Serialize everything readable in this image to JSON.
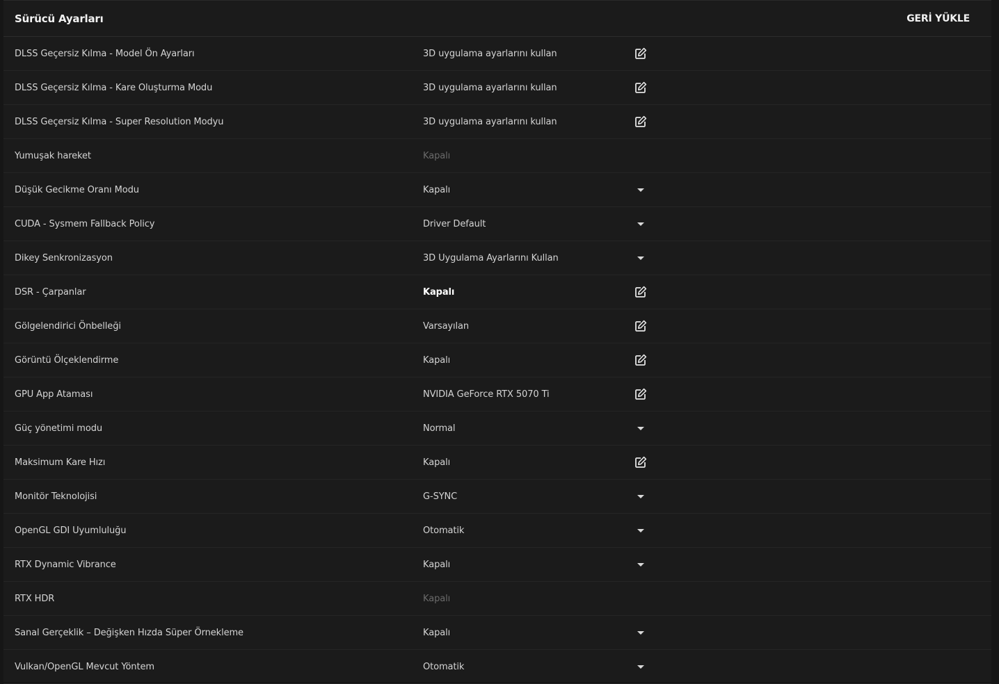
{
  "header": {
    "title": "Sürücü Ayarları",
    "restore_label": "GERİ YÜKLE"
  },
  "settings": [
    {
      "label": "DLSS Geçersiz Kılma - Model Ön Ayarları",
      "value": "3D uygulama ayarlarını kullan",
      "control": "edit-icon",
      "state": "normal"
    },
    {
      "label": "DLSS Geçersiz Kılma - Kare Oluşturma Modu",
      "value": "3D uygulama ayarlarını kullan",
      "control": "edit-icon",
      "state": "normal"
    },
    {
      "label": "DLSS Geçersiz Kılma - Super Resolution Modyu",
      "value": "3D uygulama ayarlarını kullan",
      "control": "edit-icon",
      "state": "normal"
    },
    {
      "label": "Yumuşak hareket",
      "value": "Kapalı",
      "control": "none",
      "state": "disabled"
    },
    {
      "label": "Düşük Gecikme Oranı Modu",
      "value": "Kapalı",
      "control": "dropdown-caret-icon",
      "state": "normal"
    },
    {
      "label": "CUDA - Sysmem Fallback Policy",
      "value": "Driver Default",
      "control": "dropdown-caret-icon",
      "state": "normal"
    },
    {
      "label": "Dikey Senkronizasyon",
      "value": "3D Uygulama Ayarlarını Kullan",
      "control": "dropdown-caret-icon",
      "state": "normal"
    },
    {
      "label": "DSR - Çarpanlar",
      "value": "Kapalı",
      "control": "edit-icon",
      "state": "bold"
    },
    {
      "label": "Gölgelendirici Önbelleği",
      "value": "Varsayılan",
      "control": "edit-icon",
      "state": "normal"
    },
    {
      "label": "Görüntü Ölçeklendirme",
      "value": "Kapalı",
      "control": "edit-icon",
      "state": "normal"
    },
    {
      "label": "GPU App Ataması",
      "value": "NVIDIA GeForce RTX 5070 Ti",
      "control": "edit-icon",
      "state": "normal"
    },
    {
      "label": "Güç yönetimi modu",
      "value": "Normal",
      "control": "dropdown-caret-icon",
      "state": "normal"
    },
    {
      "label": "Maksimum Kare Hızı",
      "value": "Kapalı",
      "control": "edit-icon",
      "state": "normal"
    },
    {
      "label": "Monitör Teknolojisi",
      "value": "G-SYNC",
      "control": "dropdown-caret-icon",
      "state": "normal"
    },
    {
      "label": "OpenGL GDI Uyumluluğu",
      "value": "Otomatik",
      "control": "dropdown-caret-icon",
      "state": "normal"
    },
    {
      "label": "RTX Dynamic Vibrance",
      "value": "Kapalı",
      "control": "dropdown-caret-icon",
      "state": "normal"
    },
    {
      "label": "RTX HDR",
      "value": "Kapalı",
      "control": "none",
      "state": "disabled"
    },
    {
      "label": "Sanal Gerçeklik – Değişken Hızda Süper Örnekleme",
      "value": "Kapalı",
      "control": "dropdown-caret-icon",
      "state": "normal"
    },
    {
      "label": "Vulkan/OpenGL Mevcut Yöntem",
      "value": "Otomatik",
      "control": "dropdown-caret-icon",
      "state": "normal"
    }
  ],
  "colors": {
    "background": "#1b1b1b",
    "text": "#d4d4d4",
    "disabled_text": "#6b6b6b",
    "divider": "#252525"
  }
}
